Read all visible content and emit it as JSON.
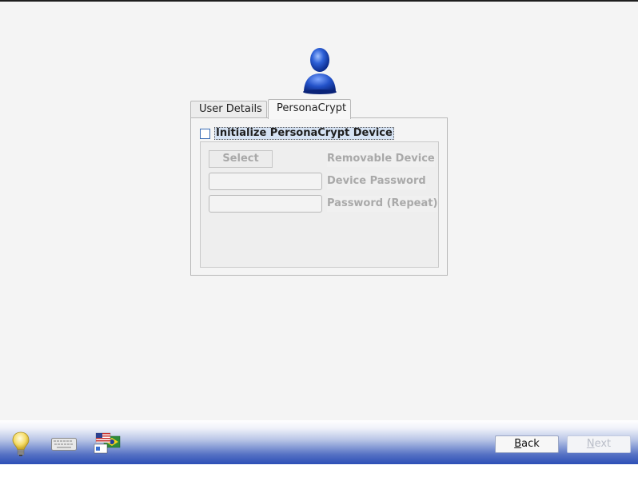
{
  "tabs": {
    "user_details": "User Details",
    "personacrypt": "PersonaCrypt"
  },
  "personacrypt": {
    "init_label": "Initialize PersonaCrypt Device",
    "init_checked": false,
    "select_button": "Select",
    "removable_device_label": "Removable Device",
    "device_password_label": "Device Password",
    "device_password_value": "",
    "password_repeat_label": "Password (Repeat)",
    "password_repeat_value": ""
  },
  "footer": {
    "back_mnemonic": "B",
    "back_rest": "ack",
    "next_mnemonic": "N",
    "next_rest": "ext"
  },
  "icons": {
    "avatar": "user-silhouette-icon",
    "hint": "lightbulb-icon",
    "keyboard": "keyboard-icon",
    "language": "language-flags-icon"
  },
  "colors": {
    "accent_blue": "#2c4fb6",
    "avatar_blue": "#1f4fc8"
  }
}
